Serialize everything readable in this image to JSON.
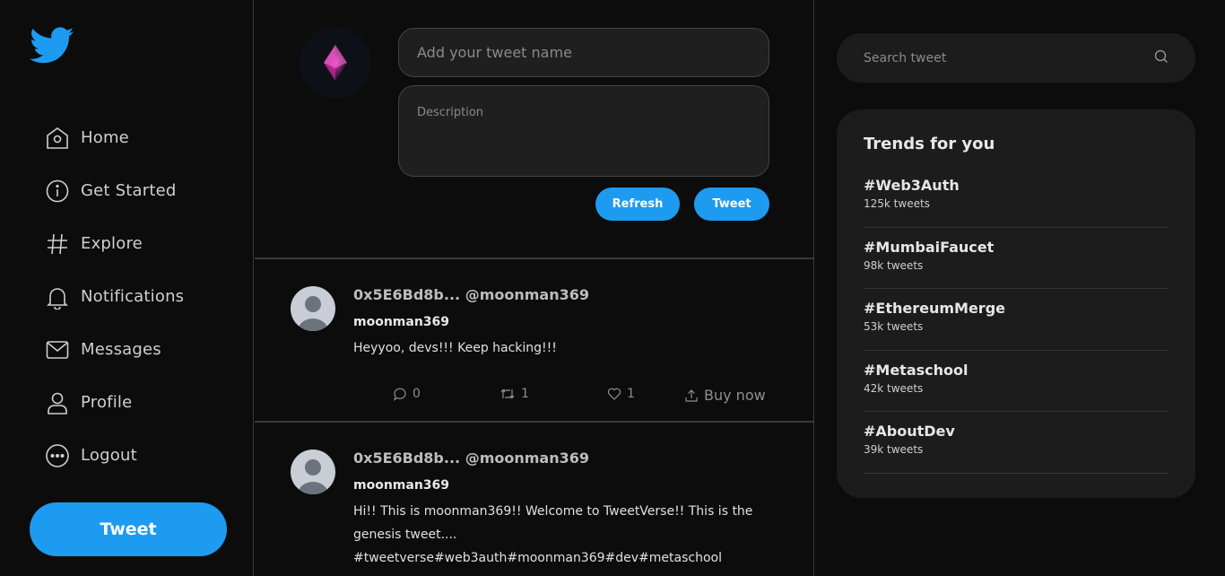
{
  "colors": {
    "accent": "#1d9bf0",
    "background": "#0c0c0c",
    "panel": "#1c1c1c"
  },
  "sidebar": {
    "items": [
      {
        "label": "Home",
        "icon": "home-icon"
      },
      {
        "label": "Get Started",
        "icon": "info-icon"
      },
      {
        "label": "Explore",
        "icon": "hashtag-icon"
      },
      {
        "label": "Notifications",
        "icon": "bell-icon"
      },
      {
        "label": "Messages",
        "icon": "mail-icon"
      },
      {
        "label": "Profile",
        "icon": "user-icon"
      },
      {
        "label": "Logout",
        "icon": "more-icon"
      }
    ],
    "tweet_button": "Tweet"
  },
  "composer": {
    "name_placeholder": "Add your tweet name",
    "desc_placeholder": "Description",
    "refresh_label": "Refresh",
    "tweet_label": "Tweet"
  },
  "tweets": [
    {
      "address": "0x5E6Bd8b...",
      "handle": "@moonman369",
      "name": "moonman369",
      "body": "Heyyoo, devs!!! Keep hacking!!!",
      "comments": "0",
      "retweets": "1",
      "likes": "1",
      "buy_label": "Buy now"
    },
    {
      "address": "0x5E6Bd8b...",
      "handle": "@moonman369",
      "name": "moonman369",
      "body": "Hi!! This is moonman369!! Welcome to TweetVerse!! This is the genesis tweet.... #tweetverse#web3auth#moonman369#dev#metaschool"
    }
  ],
  "search": {
    "placeholder": "Search tweet"
  },
  "trends": {
    "title": "Trends for you",
    "items": [
      {
        "tag": "#Web3Auth",
        "count": "125k tweets"
      },
      {
        "tag": "#MumbaiFaucet",
        "count": "98k tweets"
      },
      {
        "tag": "#EthereumMerge",
        "count": "53k tweets"
      },
      {
        "tag": "#Metaschool",
        "count": "42k tweets"
      },
      {
        "tag": "#AboutDev",
        "count": "39k tweets"
      }
    ]
  }
}
